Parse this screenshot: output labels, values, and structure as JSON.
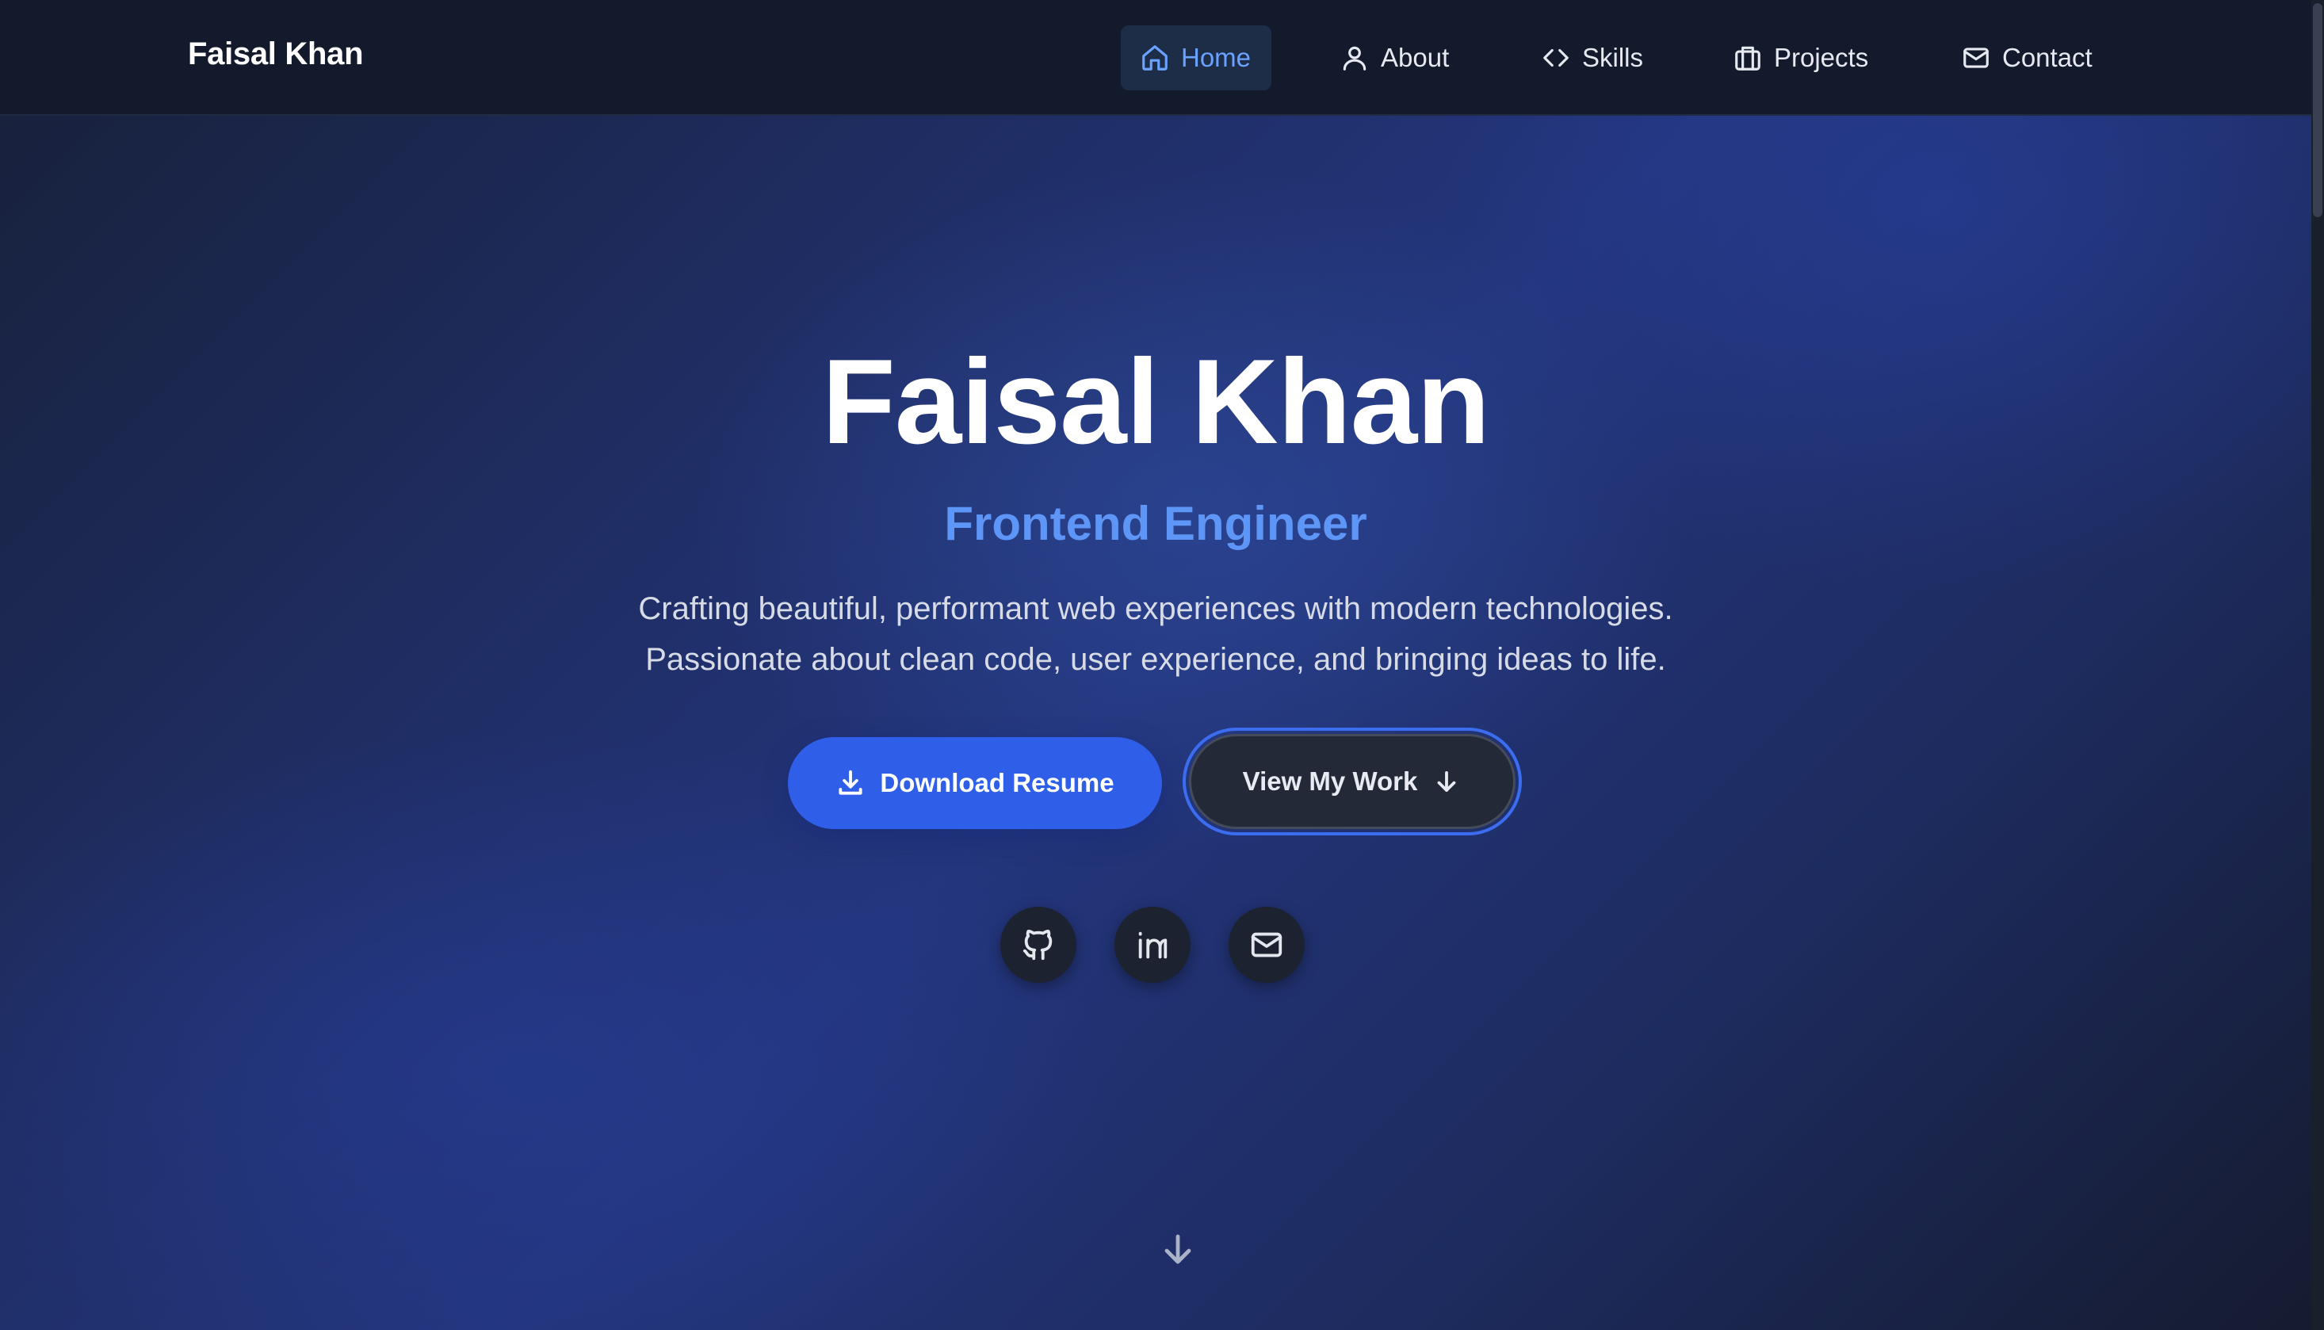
{
  "brand": "Faisal Khan",
  "nav": {
    "items": [
      {
        "label": "Home",
        "icon": "home-icon",
        "active": true
      },
      {
        "label": "About",
        "icon": "user-icon",
        "active": false
      },
      {
        "label": "Skills",
        "icon": "code-icon",
        "active": false
      },
      {
        "label": "Projects",
        "icon": "briefcase-icon",
        "active": false
      },
      {
        "label": "Contact",
        "icon": "mail-icon",
        "active": false
      }
    ]
  },
  "hero": {
    "title": "Faisal Khan",
    "subtitle": "Frontend Engineer",
    "description_line1": "Crafting beautiful, performant web experiences with modern technologies.",
    "description_line2": "Passionate about clean code, user experience, and bringing ideas to life.",
    "primary_button": "Download Resume",
    "secondary_button": "View My Work"
  },
  "social": [
    {
      "icon": "github-icon"
    },
    {
      "icon": "linkedin-icon"
    },
    {
      "icon": "mail-icon"
    }
  ],
  "colors": {
    "accent": "#2f5ee8",
    "subtitle": "#5d96f6",
    "nav_active": "#6aa3ff",
    "navbar_bg": "#131a2b"
  }
}
